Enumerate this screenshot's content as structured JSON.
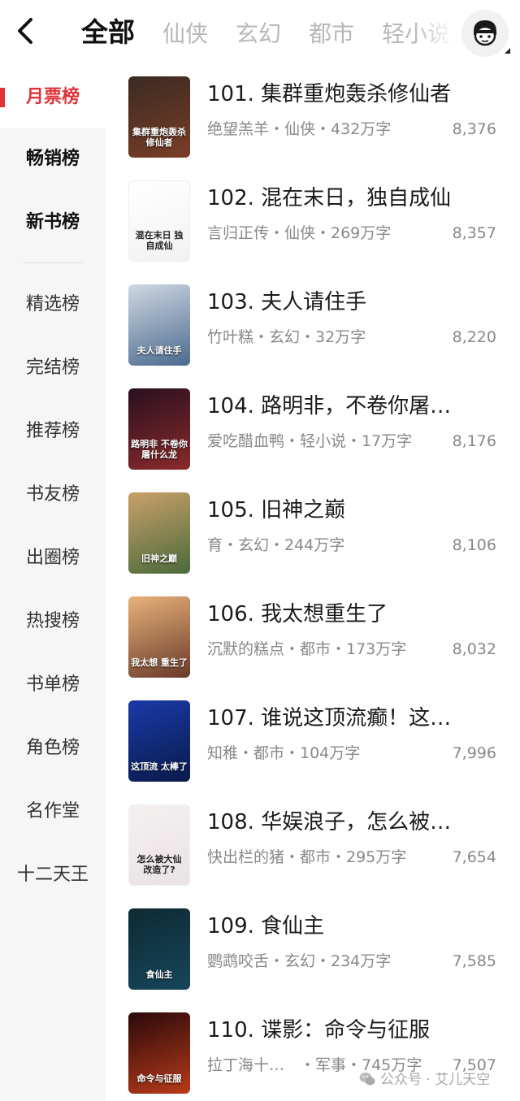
{
  "header": {
    "tabs": [
      {
        "label": "全部",
        "active": true
      },
      {
        "label": "仙侠",
        "active": false
      },
      {
        "label": "玄幻",
        "active": false
      },
      {
        "label": "都市",
        "active": false
      },
      {
        "label": "轻小说",
        "active": false
      }
    ],
    "back_icon": "chevron-left-icon",
    "avatar_icon": "user-avatar-icon"
  },
  "sidebar": {
    "items": [
      {
        "label": "月票榜",
        "state": "active"
      },
      {
        "label": "畅销榜",
        "state": "bold"
      },
      {
        "label": "新书榜",
        "state": "bold"
      },
      {
        "label": "精选榜",
        "state": "normal"
      },
      {
        "label": "完结榜",
        "state": "normal"
      },
      {
        "label": "推荐榜",
        "state": "normal"
      },
      {
        "label": "书友榜",
        "state": "normal"
      },
      {
        "label": "出圈榜",
        "state": "normal"
      },
      {
        "label": "热搜榜",
        "state": "normal"
      },
      {
        "label": "书单榜",
        "state": "normal"
      },
      {
        "label": "角色榜",
        "state": "normal"
      },
      {
        "label": "名作堂",
        "state": "normal"
      },
      {
        "label": "十二天王",
        "state": "normal"
      }
    ],
    "accent_color": "#e0333a"
  },
  "books": [
    {
      "title": "101. 集群重炮轰杀修仙者",
      "meta": "绝望羔羊・仙侠・432万字",
      "score": "8,376",
      "cover_text": "集群重炮轰杀修仙者",
      "cover_colors": [
        "#3a2a22",
        "#7a3e26"
      ],
      "cover_dark": false
    },
    {
      "title": "102. 混在末日，独自成仙",
      "meta": "言归正传・仙侠・269万字",
      "score": "8,357",
      "cover_text": "混在末日 独自成仙",
      "cover_colors": [
        "#ffffff",
        "#f2f2f2"
      ],
      "cover_dark": true
    },
    {
      "title": "103. 夫人请住手",
      "meta": "竹叶糕・玄幻・32万字",
      "score": "8,220",
      "cover_text": "夫人请住手",
      "cover_colors": [
        "#cfd8e3",
        "#4b6a8e"
      ],
      "cover_dark": false
    },
    {
      "title": "104. 路明非，不卷你屠…",
      "meta": "爱吃醋血鸭・轻小说・17万字",
      "score": "8,176",
      "cover_text": "路明非 不卷你屠什么龙",
      "cover_colors": [
        "#2a1020",
        "#8a2a2a"
      ],
      "cover_dark": false
    },
    {
      "title": "105. 旧神之巅",
      "meta": "育・玄幻・244万字",
      "score": "8,106",
      "cover_text": "旧神之巅",
      "cover_colors": [
        "#c9a06a",
        "#4a6a3a"
      ],
      "cover_dark": false
    },
    {
      "title": "106. 我太想重生了",
      "meta": "沉默的糕点・都市・173万字",
      "score": "8,032",
      "cover_text": "我太想 重生了",
      "cover_colors": [
        "#e8b27a",
        "#6a3a2a"
      ],
      "cover_dark": false
    },
    {
      "title": "107. 谁说这顶流癫！这…",
      "meta": "知稚・都市・104万字",
      "score": "7,996",
      "cover_text": "这顶流 太棒了",
      "cover_colors": [
        "#1a3aa8",
        "#0a1a4a"
      ],
      "cover_dark": false
    },
    {
      "title": "108. 华娱浪子，怎么被…",
      "meta": "快出栏的猪・都市・295万字",
      "score": "7,654",
      "cover_text": "怎么被大仙 改造了?",
      "cover_colors": [
        "#f5f0f0",
        "#e9e2e6"
      ],
      "cover_dark": true
    },
    {
      "title": "109. 食仙主",
      "meta": "鹦鹉咬舌・玄幻・234万字",
      "score": "7,585",
      "cover_text": "食仙主",
      "cover_colors": [
        "#0f2a34",
        "#16465a"
      ],
      "cover_dark": false
    },
    {
      "title": "110. 谍影：命令与征服",
      "meta": "拉丁海十…　・军事・745万字",
      "score": "7,507",
      "cover_text": "命令与征服",
      "cover_colors": [
        "#2a0a0a",
        "#b83a1a"
      ],
      "cover_dark": false
    }
  ],
  "watermark": {
    "text": "公众号 · 艾儿天空",
    "icon": "wechat-icon"
  }
}
